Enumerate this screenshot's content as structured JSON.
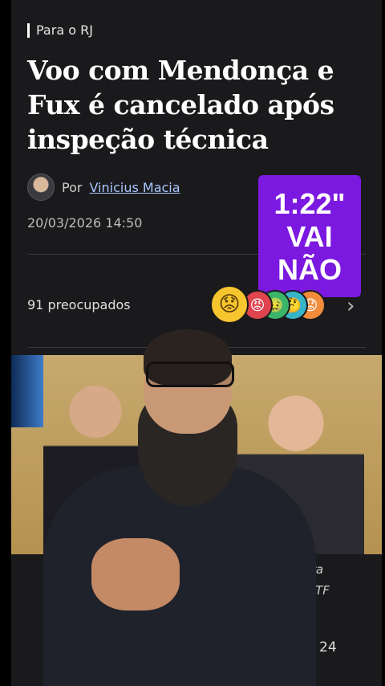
{
  "article": {
    "section": "Para o RJ",
    "title": "Voo com Mendonça e Fux é cancelado após inspeção técnica",
    "byline_prefix": "Por",
    "author": "Vinicius Macia",
    "date": "20/03/2026 14:50"
  },
  "reactions": {
    "count_text": "91 preocupados",
    "main_emoji": "😟",
    "emojis": [
      "😡",
      "🤢",
      "🤔",
      "😟"
    ],
    "emoji_colors": [
      "#e0444e",
      "#3ab56a",
      "#37b5c9",
      "#f08c3a"
    ]
  },
  "photo": {
    "caption_left": "",
    "caption_right_line1": "para",
    "caption_right_line2": "n/STF"
  },
  "comments": {
    "count": "24"
  },
  "overlay": {
    "line1": "1:22\"",
    "line2": "VAI",
    "line3": "NÃO"
  }
}
